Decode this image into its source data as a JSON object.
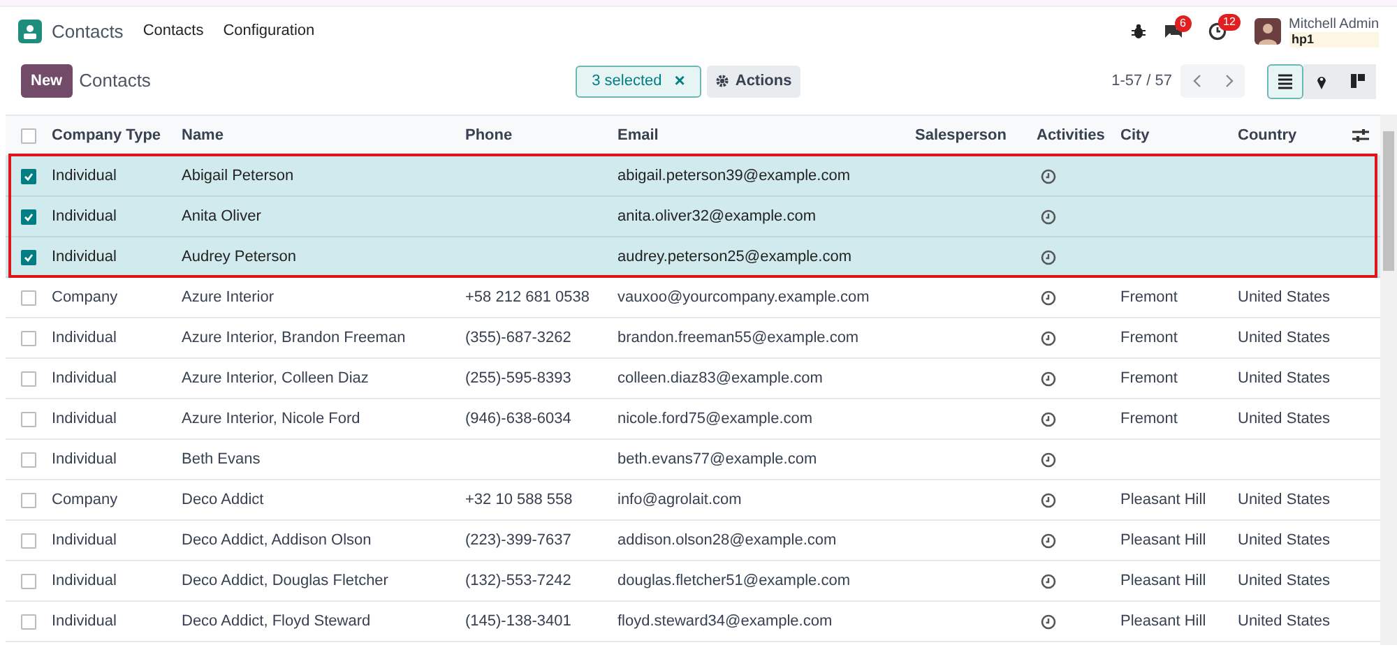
{
  "navbar": {
    "app_title": "Contacts",
    "menu": [
      "Contacts",
      "Configuration"
    ],
    "messages_count": "6",
    "activities_count": "12",
    "user_name": "Mitchell Admin",
    "company": "hp1"
  },
  "control_panel": {
    "new_button": "New",
    "breadcrumb": "Contacts",
    "selection": "3 selected",
    "close": "×",
    "actions": "Actions",
    "pager": "1-57 / 57",
    "views": [
      {
        "kind": "list",
        "selected": true
      },
      {
        "kind": "map",
        "selected": false
      },
      {
        "kind": "kanban",
        "selected": false
      }
    ]
  },
  "table": {
    "select_all": false,
    "columns": [
      "Company Type",
      "Name",
      "Phone",
      "Email",
      "Salesperson",
      "Activities",
      "City",
      "Country"
    ],
    "rows": [
      {
        "selected": true,
        "type": "Individual",
        "name": "Abigail Peterson",
        "email": "abigail.peterson39@example.com"
      },
      {
        "selected": true,
        "type": "Individual",
        "name": "Anita Oliver",
        "email": "anita.oliver32@example.com"
      },
      {
        "selected": true,
        "type": "Individual",
        "name": "Audrey Peterson",
        "email": "audrey.peterson25@example.com"
      },
      {
        "selected": false,
        "type": "Company",
        "name": "Azure Interior",
        "phone": "+58 212 681 0538",
        "email": "vauxoo@yourcompany.example.com",
        "city": "Fremont",
        "country": "United States"
      },
      {
        "selected": false,
        "type": "Individual",
        "name": "Azure Interior, Brandon Freeman",
        "phone": "(355)-687-3262",
        "email": "brandon.freeman55@example.com",
        "city": "Fremont",
        "country": "United States"
      },
      {
        "selected": false,
        "type": "Individual",
        "name": "Azure Interior, Colleen Diaz",
        "phone": "(255)-595-8393",
        "email": "colleen.diaz83@example.com",
        "city": "Fremont",
        "country": "United States"
      },
      {
        "selected": false,
        "type": "Individual",
        "name": "Azure Interior, Nicole Ford",
        "phone": "(946)-638-6034",
        "email": "nicole.ford75@example.com",
        "city": "Fremont",
        "country": "United States"
      },
      {
        "selected": false,
        "type": "Individual",
        "name": "Beth Evans",
        "email": "beth.evans77@example.com"
      },
      {
        "selected": false,
        "type": "Company",
        "name": "Deco Addict",
        "phone": "+32 10 588 558",
        "email": "info@agrolait.com",
        "city": "Pleasant Hill",
        "country": "United States"
      },
      {
        "selected": false,
        "type": "Individual",
        "name": "Deco Addict, Addison Olson",
        "phone": "(223)-399-7637",
        "email": "addison.olson28@example.com",
        "city": "Pleasant Hill",
        "country": "United States"
      },
      {
        "selected": false,
        "type": "Individual",
        "name": "Deco Addict, Douglas Fletcher",
        "phone": "(132)-553-7242",
        "email": "douglas.fletcher51@example.com",
        "city": "Pleasant Hill",
        "country": "United States"
      },
      {
        "selected": false,
        "type": "Individual",
        "name": "Deco Addict, Floyd Steward",
        "phone": "(145)-138-3401",
        "email": "floyd.steward34@example.com",
        "city": "Pleasant Hill",
        "country": "United States"
      }
    ]
  }
}
